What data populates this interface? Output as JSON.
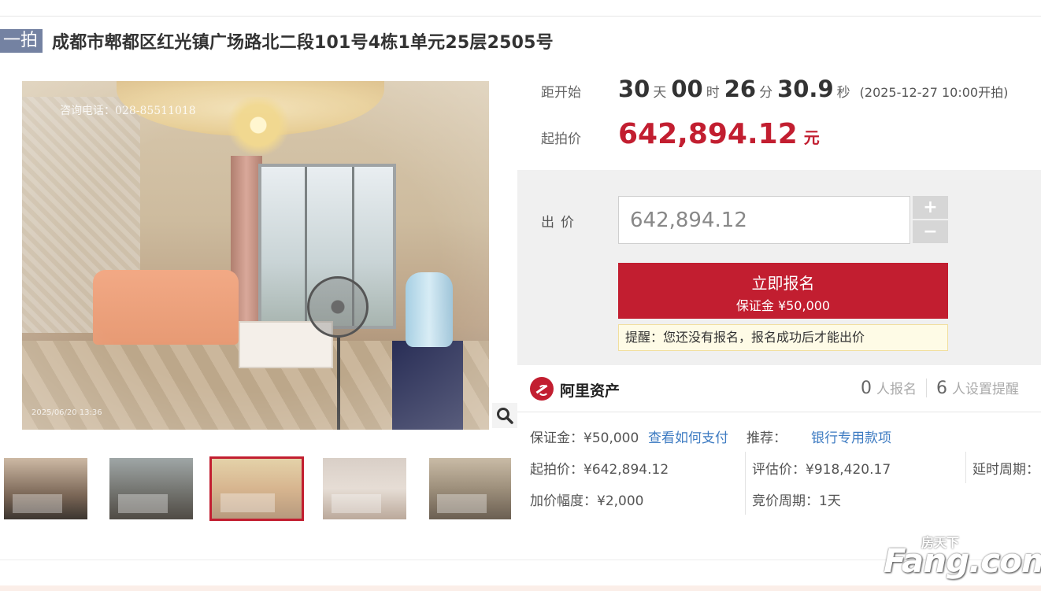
{
  "header": {
    "round_badge": "一拍",
    "title": "成都市郫都区红光镇广场路北二段101号4栋1单元25层2505号"
  },
  "gallery": {
    "watermark_phone": "咨询电话：028-85511018",
    "watermark_date": "2025/06/20 13:36",
    "zoom_icon": "magnifier-icon",
    "thumbnails_count": 5,
    "active_thumbnail": 3
  },
  "countdown": {
    "label": "距开始",
    "days": "30",
    "days_unit": "天",
    "hours": "00",
    "hours_unit": "时",
    "minutes": "26",
    "minutes_unit": "分",
    "seconds": "30.9",
    "seconds_unit": "秒",
    "start_time": "(2025-12-27 10:00开拍)"
  },
  "start_price": {
    "label": "起拍价",
    "value": "642,894.12",
    "unit": "元",
    "color": "#c21e30"
  },
  "bid": {
    "label": "出价",
    "input_value": "642,894.12",
    "plus": "+",
    "minus": "−",
    "signup_label": "立即报名",
    "deposit_label": "保证金 ¥50,000",
    "reminder": "提醒：您还没有报名，报名成功后才能出价"
  },
  "platform": {
    "name": "阿里资产",
    "signup_count": "0",
    "signup_text": "人报名",
    "reminder_count": "6",
    "reminder_text": "人设置提醒"
  },
  "details": {
    "deposit": "保证金：¥50,000",
    "how_to_pay": "查看如何支付",
    "recommend": "推荐：",
    "bank_loan": "银行专用款项",
    "start_price": "起拍价：¥642,894.12",
    "appraisal": "评估价：¥918,420.17",
    "delay_period": "延时周期：",
    "increment": "加价幅度：¥2,000",
    "bid_period": "竞价周期：1天"
  },
  "watermark": {
    "site_cn": "房天下",
    "site_en": "Fang.com"
  },
  "colors": {
    "accent": "#c21e30",
    "badge": "#7482a2",
    "link": "#3d7bc2"
  }
}
